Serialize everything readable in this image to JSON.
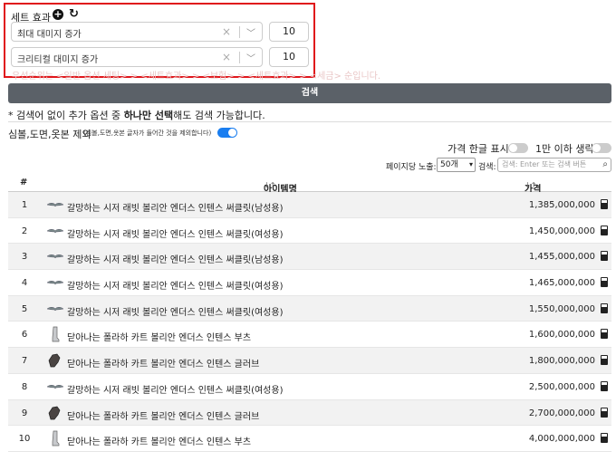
{
  "set_effect": {
    "title": "세트 효과",
    "add_icon": "plus-circle-icon",
    "refresh_icon": "refresh-icon",
    "options": [
      {
        "label": "최대 대미지 증가",
        "value": "10"
      },
      {
        "label": "크리티컬 대미지 증가",
        "value": "10"
      }
    ],
    "overflow_hint": "우선순위는 <일반 옵션 세팅> > <세트효과> > <보험> > <세트효과> > <세금> 순입니다."
  },
  "search_button": "검색",
  "note": {
    "prefix": "* 검색어 없이 추가 옵션 중 ",
    "bold": "하나만 선택",
    "suffix": "해도 검색 가능합니다."
  },
  "exclude": {
    "label": "심볼,도면,옷본 제외",
    "sub": "(심볼,도면,옷본 글자가 들어간 것을 제외합니다)",
    "on": true
  },
  "toggles": {
    "korean_price_label": "가격 한글 표시:",
    "korean_price_on": false,
    "omit_under_label": "1만 이하 생략:",
    "omit_under_on": false
  },
  "pagination": {
    "per_page_label": "페이지당 노출:",
    "per_page_value": "50개",
    "search_label": "검색:",
    "search_placeholder": "검색: Enter 또는 검색 버튼"
  },
  "table": {
    "headers": {
      "num": "#",
      "name": "아이템명",
      "price": "가격"
    },
    "rows": [
      {
        "num": "1",
        "icon": "wing-icon",
        "name": "갈망하는 시저 래빗 볼리안 엔더스 인텐스 써클릿(남성용)",
        "price": "1,385,000,000"
      },
      {
        "num": "2",
        "icon": "wing-icon",
        "name": "갈망하는 시저 래빗 볼리안 엔더스 인텐스 써클릿(여성용)",
        "price": "1,450,000,000"
      },
      {
        "num": "3",
        "icon": "wing-icon",
        "name": "갈망하는 시저 래빗 볼리안 엔더스 인텐스 써클릿(남성용)",
        "price": "1,455,000,000"
      },
      {
        "num": "4",
        "icon": "wing-icon",
        "name": "갈망하는 시저 래빗 볼리안 엔더스 인텐스 써클릿(여성용)",
        "price": "1,465,000,000"
      },
      {
        "num": "5",
        "icon": "wing-icon",
        "name": "갈망하는 시저 래빗 볼리안 엔더스 인텐스 써클릿(여성용)",
        "price": "1,550,000,000"
      },
      {
        "num": "6",
        "icon": "boot-icon",
        "name": "닫아나는 폴라하 카트 볼리안 엔더스 인텐스 부츠",
        "price": "1,600,000,000"
      },
      {
        "num": "7",
        "icon": "glove-icon",
        "name": "닫아나는 폴라하 카트 볼리안 엔더스 인텐스 글러브",
        "price": "1,800,000,000"
      },
      {
        "num": "8",
        "icon": "wing-icon",
        "name": "갈망하는 시저 래빗 볼리안 엔더스 인텐스 써클릿(여성용)",
        "price": "2,500,000,000"
      },
      {
        "num": "9",
        "icon": "glove-icon",
        "name": "닫아나는 폴라하 카트 볼리안 엔더스 인텐스 글러브",
        "price": "2,700,000,000"
      },
      {
        "num": "10",
        "icon": "boot-icon",
        "name": "닫아나는 폴라하 카트 볼리안 엔더스 인텐스 부츠",
        "price": "4,000,000,000"
      }
    ]
  }
}
